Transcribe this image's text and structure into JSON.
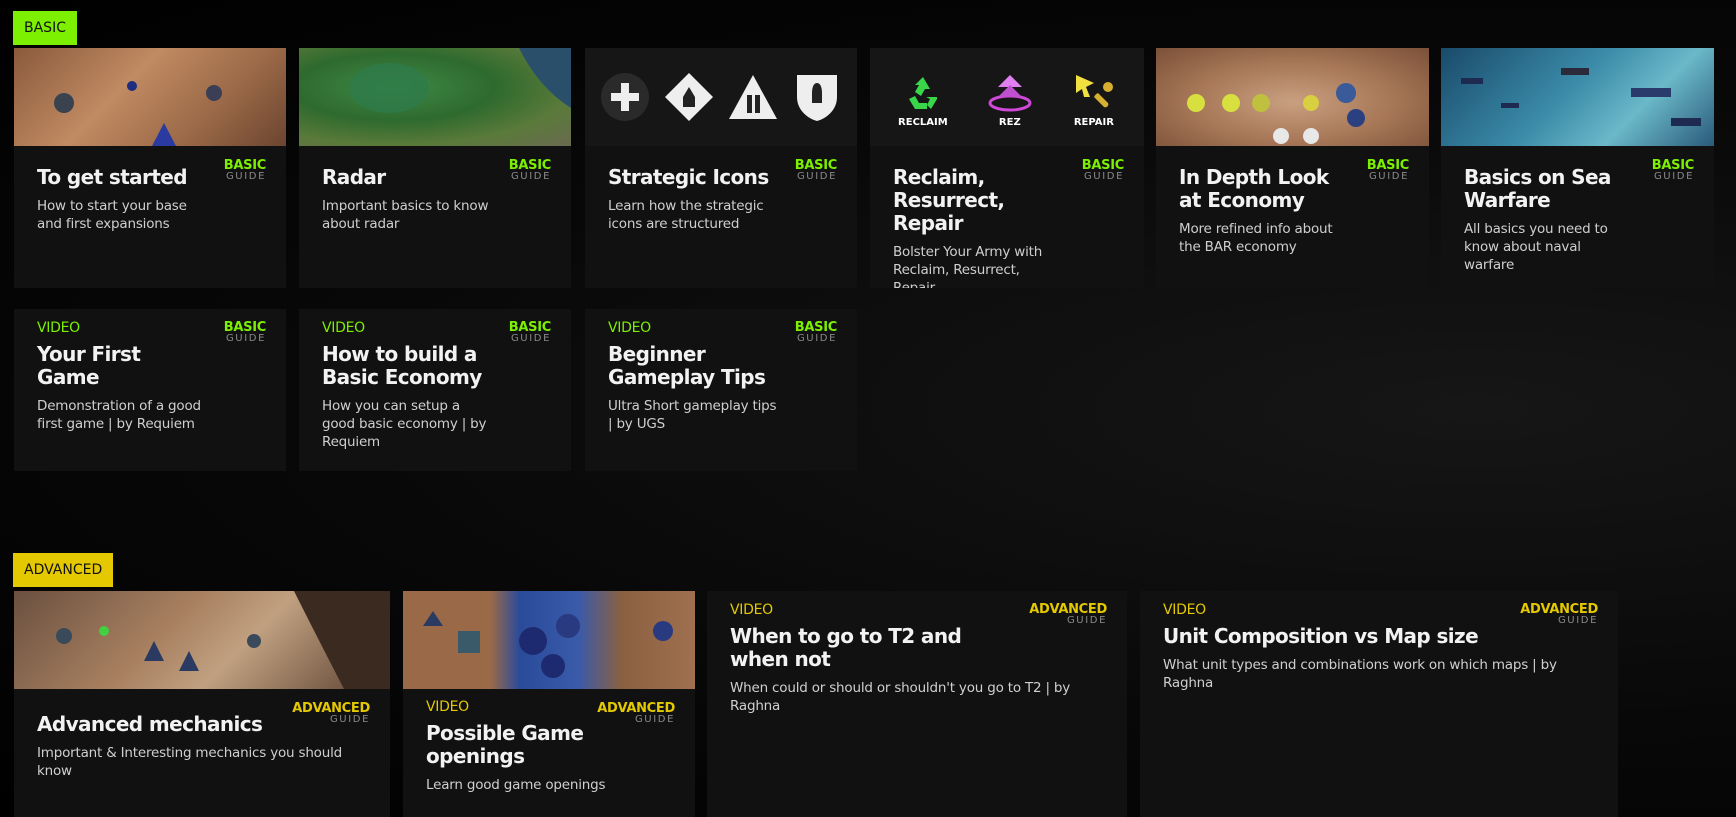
{
  "sections": {
    "basic": "BASIC",
    "advanced": "ADVANCED"
  },
  "badges": {
    "basic": "BASIC",
    "advanced": "ADVANCED",
    "guide": "GUIDE",
    "video": "VIDEO"
  },
  "basic_cards": [
    {
      "title": "To get started",
      "desc": "How to start your base and first expansions"
    },
    {
      "title": "Radar",
      "desc": "Important basics to know about radar"
    },
    {
      "title": "Strategic Icons",
      "desc": "Learn how the strategic icons are structured"
    },
    {
      "title": "Reclaim, Resurrect, Repair",
      "desc": "Bolster Your Army with Reclaim, Resurrect, Repair"
    },
    {
      "title": "In Depth Look at Economy",
      "desc": "More refined info about the BAR economy"
    },
    {
      "title": "Basics on Sea Warfare",
      "desc": "All basics you need to know about naval warfare"
    }
  ],
  "basic_videos": [
    {
      "title": "Your First Game",
      "desc": "Demonstration of a good first game | by Requiem"
    },
    {
      "title": "How to build a Basic Economy",
      "desc": "How you can setup a good basic economy | by Requiem"
    },
    {
      "title": "Beginner Gameplay Tips",
      "desc": "Ultra Short gameplay tips | by UGS"
    }
  ],
  "advanced_cards": [
    {
      "title": "Advanced mechanics",
      "desc": "Important & Interesting mechanics you should know"
    },
    {
      "title": "Possible Game openings",
      "desc": "Learn good game openings"
    },
    {
      "title": "When to go to T2 and when not",
      "desc": "When could or should or shouldn't you go to T2 | by Raghna"
    },
    {
      "title": "Unit Composition vs Map size",
      "desc": "What unit types and combinations work on which maps | by Raghna"
    }
  ],
  "rrr_labels": {
    "reclaim": "RECLAIM",
    "rez": "REZ",
    "repair": "REPAIR"
  },
  "colors": {
    "basic_accent": "#7cf000",
    "advanced_accent": "#e4c800",
    "card_bg": "#111111"
  }
}
